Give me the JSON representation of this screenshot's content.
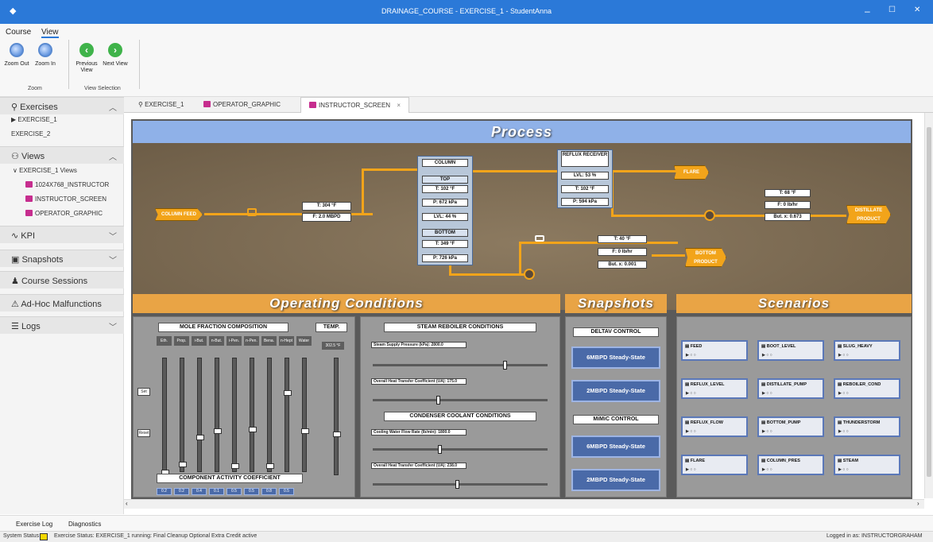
{
  "window": {
    "title": "DRAINAGE_COURSE - EXERCISE_1 - StudentAnna",
    "minimize": "‒",
    "maximize": "☐",
    "close": "✕"
  },
  "ribbon": {
    "menu": [
      "Course",
      "View"
    ],
    "zoom_out": "Zoom Out",
    "zoom_in": "Zoom In",
    "previous_view": "Previous View",
    "next_view": "Next View",
    "group_zoom": "Zoom",
    "group_view_selection": "View Selection"
  },
  "sidebar": {
    "exercises": "Exercises",
    "exercise_items": [
      "EXERCISE_1",
      "EXERCISE_2"
    ],
    "views": "Views",
    "views_group": "EXERCISE_1 Views",
    "view_items": [
      "1024X768_INSTRUCTOR",
      "INSTRUCTOR_SCREEN",
      "OPERATOR_GRAPHIC"
    ],
    "kpi": "KPI",
    "snapshots": "Snapshots",
    "course_sessions": "Course Sessions",
    "adhoc": "Ad-Hoc Malfunctions",
    "logs": "Logs"
  },
  "tabs": [
    {
      "label": "EXERCISE_1",
      "icon": "person-icon"
    },
    {
      "label": "OPERATOR_GRAPHIC",
      "icon": "graphic-icon"
    },
    {
      "label": "INSTRUCTOR_SCREEN",
      "icon": "graphic-icon",
      "active": true
    }
  ],
  "process": {
    "title": "Process",
    "column_feed": "COLUMN FEED",
    "feed_t": "T: 304 °F",
    "feed_f": "F: 2.0 MBPD",
    "column": "COLUMN",
    "top": "TOP",
    "top_t": "T: 102 °F",
    "top_p": "P: 672 kPa",
    "lvl": "LVL: 44 %",
    "bottom": "BOTTOM",
    "bot_t": "T: 349 °F",
    "bot_p": "P: 726 kPa",
    "reflux_receiver": "REFLUX RECEIVER",
    "rr_lvl": "LVL: 53 %",
    "rr_t": "T: 102 °F",
    "rr_p": "P: 594 kPa",
    "flare": "FLARE",
    "dist_t": "T: 68 °F",
    "dist_f": "F: 0 lb/hr",
    "dist_but": "But. x: 0.673",
    "distillate_product": "DISTILLATE PRODUCT",
    "bp_t": "T: 40 °F",
    "bp_f": "F: 0 lb/hr",
    "bp_but": "But. x: 0.001",
    "bottom_product": "BOTTOM PRODUCT"
  },
  "operating": {
    "title": "Operating Conditions",
    "mole_fraction": "MOLE FRACTION COMPOSITION",
    "temp": "TEMP.",
    "components": [
      "Eth.",
      "Prop.",
      "i-But.",
      "n-But.",
      "i-Pen.",
      "n-Pen.",
      "Bena.",
      "n-Hept",
      "Water"
    ],
    "temp_value": "302.5 °F",
    "set_btn": "Set",
    "reset_btn": "Reset",
    "component_activity": "COMPONENT ACTIVITY COEFFICIENT",
    "activity_values": [
      "0.2",
      "0.2",
      "0.4",
      "0.1",
      "0.5",
      "0.5",
      "0.8",
      "0.5"
    ],
    "steam_reboiler": "STEAM REBOILER CONDITIONS",
    "steam_pressure": "Steam Supply Pressure (kPa): 2800.0",
    "steam_ua": "Overall Heat Transfer Coefficient (UA): 175.0",
    "condenser": "CONDENSER COOLANT CONDITIONS",
    "cooling_flow": "Cooling Water Flow Rate (lb/min): 1800.0",
    "cond_ua": "Overall Heat Transfer Coefficient (UA): 238.0"
  },
  "snapshots": {
    "title": "Snapshots",
    "deltav": "DELTAV CONTROL",
    "mimic": "MiMiC CONTROL",
    "buttons": [
      "6MBPD Steady-State",
      "2MBPD Steady-State",
      "6MBPD Steady-State",
      "2MBPD Steady-State"
    ]
  },
  "scenarios": {
    "title": "Scenarios",
    "items": [
      "FEED",
      "BOOT_LEVEL",
      "SLUG_HEAVY",
      "REFLUX_LEVEL",
      "DISTILLATE_PUMP",
      "REBOILER_COND",
      "REFLUX_FLOW",
      "BOTTOM_PUMP",
      "THUNDERSTORM",
      "FLARE",
      "COLUMN_PRES",
      "STEAM"
    ],
    "dots": "▶ ○ ○"
  },
  "bottom_tabs": [
    "Exercise Log",
    "Diagnostics"
  ],
  "status": {
    "system_status": "System Status",
    "exercise_status": "Exercise Status: EXERCISE_1 running: Final Cleanup Optional Extra Credit active",
    "logged_in": "Logged in as: INSTRUCTORGRAHAM",
    "indicator_color": "#f5d800"
  }
}
